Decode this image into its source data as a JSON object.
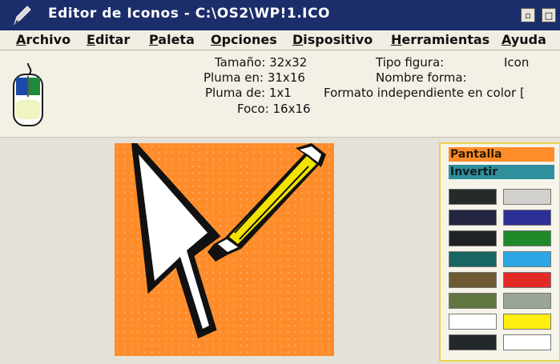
{
  "window": {
    "title": "Editor de Iconos - C:\\OS2\\WP!1.ICO",
    "minimize_glyph": "▫",
    "maximize_glyph": "□",
    "title_bar_color": "#1b2d6a"
  },
  "menu": {
    "items": [
      "Archivo",
      "Editar",
      "Paleta",
      "Opciones",
      "Dispositivo",
      "Herramientas",
      "Ayuda"
    ]
  },
  "info": {
    "tamano": "Tamaño: 32x32",
    "pluma_en": "Pluma en: 31x16",
    "pluma_de": "Pluma de: 1x1",
    "foco": "Foco: 16x16",
    "tipo_figura_label": "Tipo figura:",
    "tipo_figura_value": "Icon",
    "nombre_forma_label": "Nombre forma:",
    "formato": "Formato independiente en color ["
  },
  "canvas": {
    "background_color": "#ff8c2a",
    "content": "pencil-cursor-icon"
  },
  "palette": {
    "pantalla_label": "Pantalla",
    "invertir_label": "Invertir",
    "colors": [
      "#262b2a",
      "#d2d0cc",
      "#232543",
      "#2c2f93",
      "#1f2224",
      "#1f8a2a",
      "#176661",
      "#2ca8e4",
      "#6e5a33",
      "#e42a26",
      "#5f7640",
      "#9aa59a",
      "#ffffff",
      "#ffee10",
      "#23282a",
      "#ffffff"
    ]
  }
}
